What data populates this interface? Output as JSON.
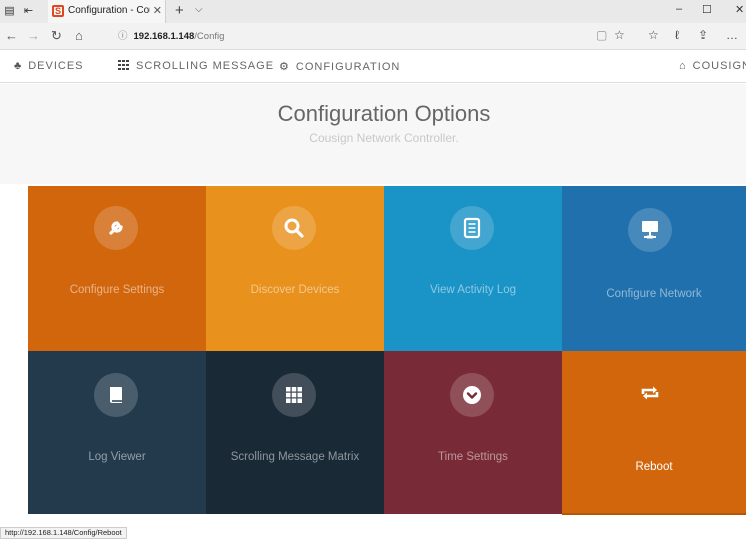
{
  "browser": {
    "tab_title": "Configuration - Cousigr",
    "url_host": "192.168.1.148",
    "url_path": "/Config"
  },
  "nav": {
    "devices": "DEVICES",
    "scrolling_message": "SCROLLING MESSAGE",
    "configuration": "CONFIGURATION",
    "brand": "COUSIGN"
  },
  "header": {
    "title": "Configuration Options",
    "subtitle": "Cousign Network Controller."
  },
  "tiles": [
    {
      "label": "Configure Settings",
      "color": "#d1660d",
      "icon": "wrench-icon"
    },
    {
      "label": "Discover Devices",
      "color": "#e8911d",
      "icon": "search-icon"
    },
    {
      "label": "View Activity Log",
      "color": "#1a93c6",
      "icon": "document-icon"
    },
    {
      "label": "Configure Network",
      "color": "#1f70ac",
      "icon": "monitor-network-icon"
    },
    {
      "label": "Log Viewer",
      "color": "#223a4c",
      "icon": "book-icon"
    },
    {
      "label": "Scrolling Message Matrix",
      "color": "#192936",
      "icon": "grid-icon"
    },
    {
      "label": "Time Settings",
      "color": "#782a36",
      "icon": "chevron-circle-icon"
    },
    {
      "label": "Reboot",
      "color": "#d1660d",
      "icon": "reboot-arrows-icon"
    }
  ],
  "status_url": "http://192.168.1.148/Config/Reboot"
}
